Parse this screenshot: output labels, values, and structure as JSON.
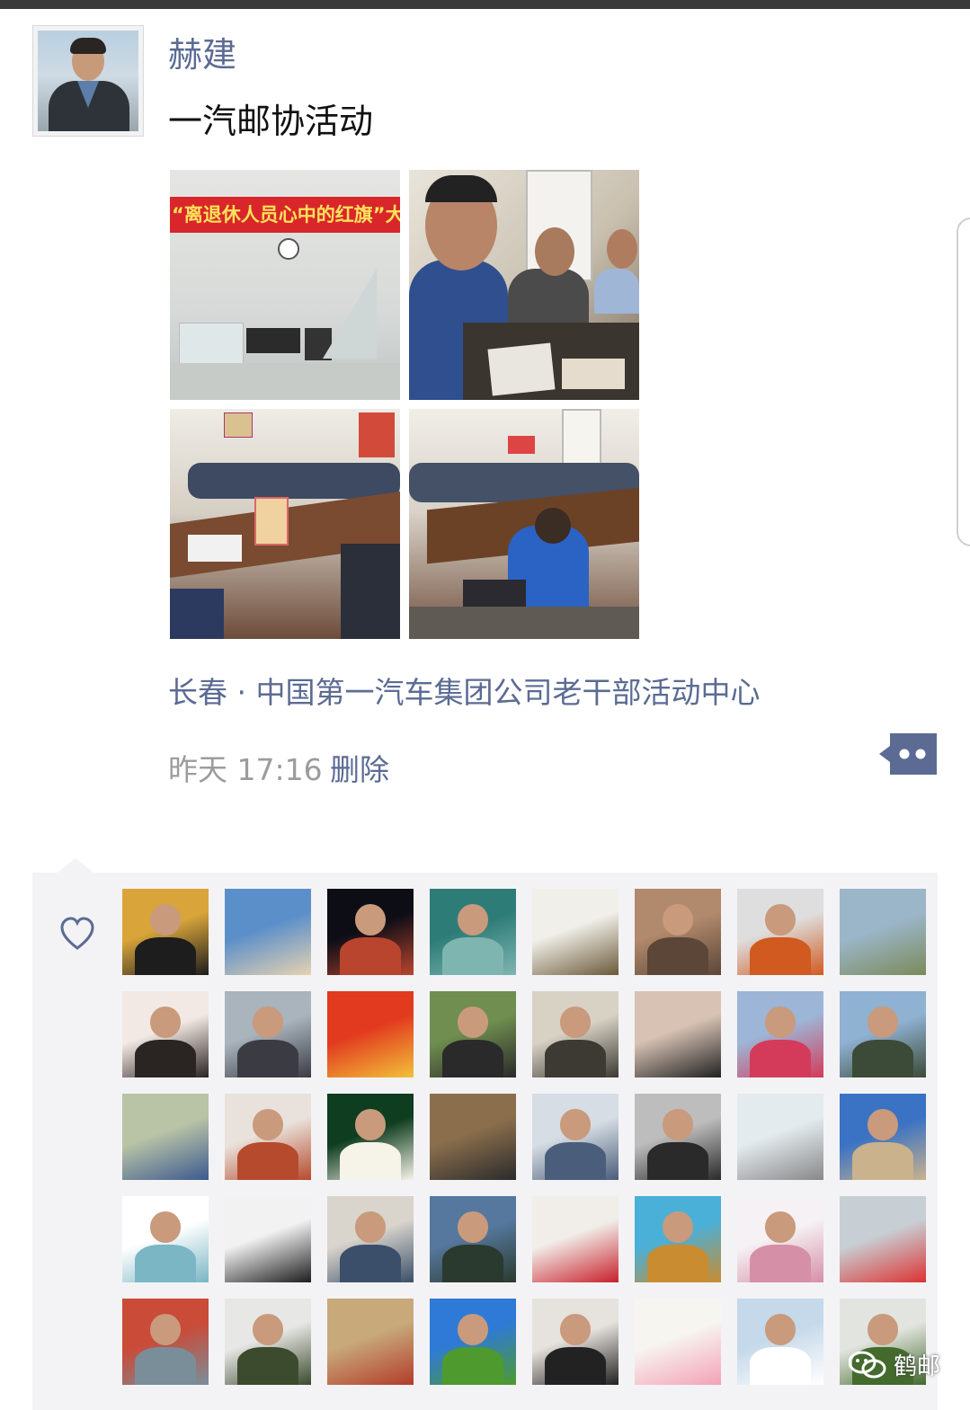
{
  "post": {
    "author": "赫建",
    "text": "一汽邮协活动",
    "photo_banner": "“离退休人员心中的红旗”大",
    "location": "长春 · 中国第一汽车集团公司老干部活动中心",
    "time": "昨天 17:16",
    "delete_label": "删除"
  },
  "icons": {
    "more": "comment-more-icon",
    "like": "heart-icon",
    "watermark": "wechat-icon"
  },
  "likes": {
    "avatar_count": 40
  },
  "watermark": {
    "text": "鹤邮"
  },
  "colors": {
    "link": "#5b6b93",
    "time": "#9c9c9c",
    "like_bg": "#f3f3f5"
  }
}
